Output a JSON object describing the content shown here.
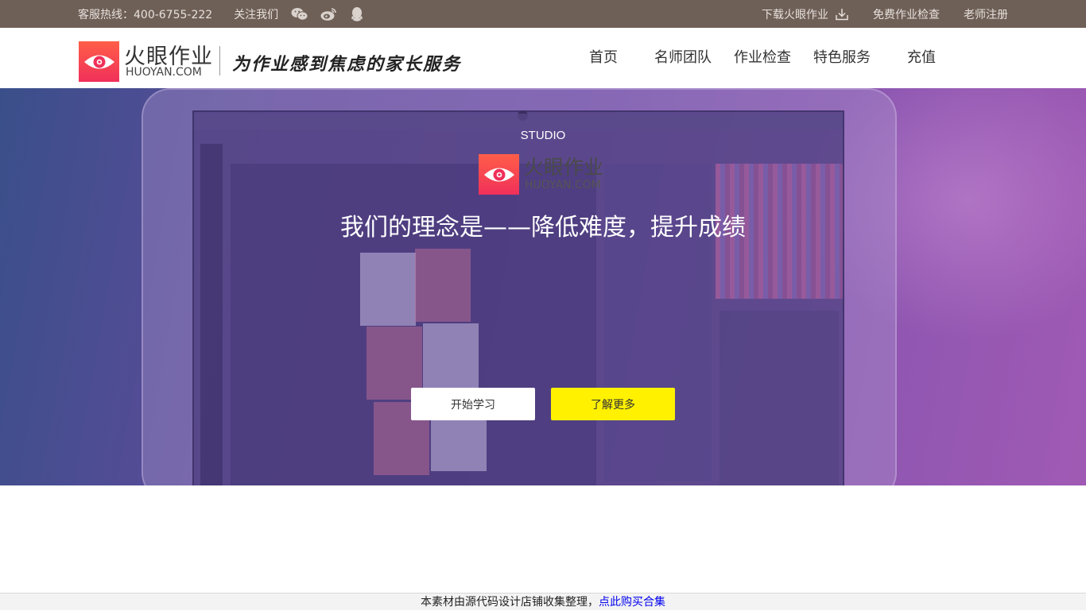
{
  "topbar": {
    "hotline": "客服热线：400-6755-222",
    "follow_label": "关注我们",
    "social_icons": [
      "wechat-icon",
      "weibo-icon",
      "qq-icon"
    ],
    "links": {
      "download": "下载火眼作业",
      "free_check": "免费作业检查",
      "teacher_register": "老师注册"
    },
    "background_color": "#6f6057"
  },
  "header": {
    "logo_cn": "火眼作业",
    "logo_en": "HUOYAN.COM",
    "slogan": "为作业感到焦虑的家长服务",
    "nav": [
      "首页",
      "名师团队",
      "作业检查",
      "特色服务",
      "充值"
    ]
  },
  "hero": {
    "studio": "STUDIO",
    "logo_cn": "火眼作业",
    "logo_en": "HUOYAN.COM",
    "title": "我们的理念是——降低难度，提升成绩",
    "buttons": {
      "start": "开始学习",
      "more": "了解更多"
    },
    "accent_color": "#fff100"
  },
  "footer": {
    "text": "本素材由源代码设计店铺收集整理，",
    "link": "点此购买合集"
  }
}
